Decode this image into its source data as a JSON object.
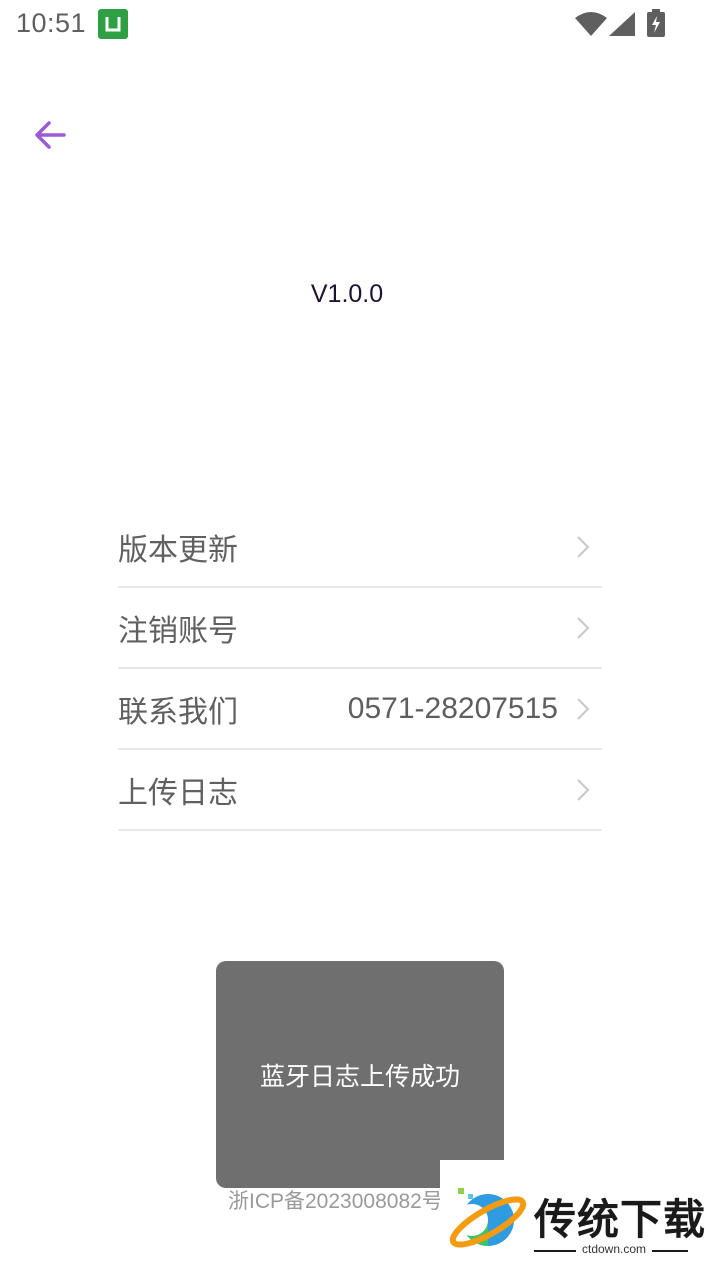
{
  "status_bar": {
    "time": "10:51",
    "icons": [
      "notification-app-icon",
      "wifi-icon",
      "signal-icon",
      "battery-charging-icon"
    ]
  },
  "header": {
    "back_icon": "arrow-left-icon",
    "accent_color": "#9b59d6"
  },
  "app": {
    "version": "V1.0.0"
  },
  "menu": {
    "items": [
      {
        "label": "版本更新",
        "value": ""
      },
      {
        "label": "注销账号",
        "value": ""
      },
      {
        "label": "联系我们",
        "value": "0571-28207515"
      },
      {
        "label": "上传日志",
        "value": ""
      }
    ]
  },
  "toast": {
    "message": "蓝牙日志上传成功"
  },
  "footer": {
    "icp": "浙ICP备2023008082号"
  },
  "watermark": {
    "title": "传统下载",
    "subtitle": "ctdown.com"
  }
}
